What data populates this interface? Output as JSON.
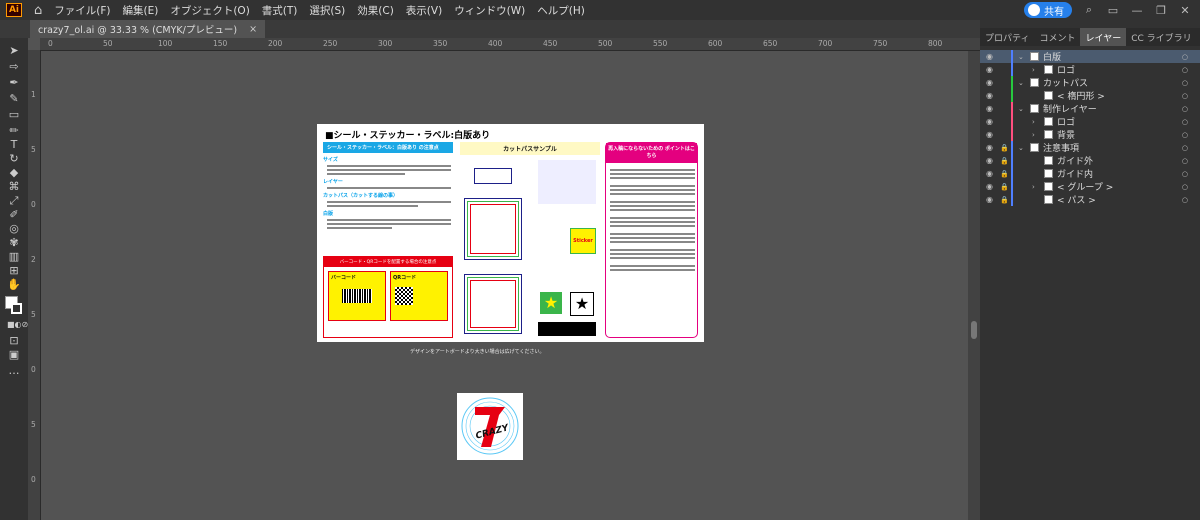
{
  "app": {
    "logo": "Ai",
    "home_icon": "home-icon"
  },
  "menu": [
    "ファイル(F)",
    "編集(E)",
    "オブジェクト(O)",
    "書式(T)",
    "選択(S)",
    "効果(C)",
    "表示(V)",
    "ウィンドウ(W)",
    "ヘルプ(H)"
  ],
  "share_label": "共有",
  "document_tab": {
    "title": "crazy7_ol.ai @ 33.33 % (CMYK/プレビュー)",
    "close": "×"
  },
  "ruler_h_labels": [
    "0",
    "50",
    "100",
    "150",
    "200",
    "250",
    "300",
    "350",
    "400",
    "450",
    "500",
    "550",
    "600",
    "650",
    "700",
    "750",
    "800"
  ],
  "ruler_v_labels": [
    "1",
    "5",
    "0",
    "2",
    "5",
    "0",
    "5",
    "0"
  ],
  "artboard": {
    "title": "■シール・ステッカー・ラベル:白版あり",
    "col1_header": "シール・ステッカー・ラベル：白版あり の注意点",
    "sections": [
      "サイズ",
      "レイヤー",
      "カットパス（カットする線の事）",
      "白版"
    ],
    "barcode_header": "バーコード・QRコードを配置する場合の注意点",
    "barcode": "バーコード",
    "qr": "QRコード",
    "col2_header": "カットパスサンプル",
    "col3_header": "再入稿にならないための ポイントはこちら",
    "sticker": "Sticker",
    "note": "デザインをアートボードより大きい場合は広げてください。"
  },
  "panel_tabs": [
    "プロパティ",
    "コメント",
    "レイヤー",
    "CC ライブラリ"
  ],
  "panel_active_tab": "レイヤー",
  "layers": [
    {
      "name": "白版",
      "level": 0,
      "expanded": true,
      "selected": true,
      "color": "#4f7fff"
    },
    {
      "name": "ロゴ",
      "level": 1,
      "expanded": false,
      "color": "#4f7fff"
    },
    {
      "name": "カットパス",
      "level": 0,
      "expanded": true,
      "color": "#27c93f"
    },
    {
      "name": "< 楕円形 >",
      "level": 1,
      "color": "#27c93f"
    },
    {
      "name": "制作レイヤー",
      "level": 0,
      "expanded": true,
      "color": "#ff4f7f"
    },
    {
      "name": "ロゴ",
      "level": 1,
      "expanded": false,
      "color": "#ff4f7f"
    },
    {
      "name": "背景",
      "level": 1,
      "expanded": false,
      "color": "#ff4f7f"
    },
    {
      "name": "注意事項",
      "level": 0,
      "expanded": true,
      "locked": true,
      "color": "#4f7fff"
    },
    {
      "name": "ガイド外",
      "level": 1,
      "locked": true,
      "color": "#4f7fff"
    },
    {
      "name": "ガイド内",
      "level": 1,
      "locked": true,
      "color": "#4f7fff"
    },
    {
      "name": "< グループ >",
      "level": 1,
      "expanded": false,
      "locked": true,
      "color": "#4f7fff"
    },
    {
      "name": "< パス >",
      "level": 1,
      "locked": true,
      "color": "#4f7fff"
    }
  ]
}
